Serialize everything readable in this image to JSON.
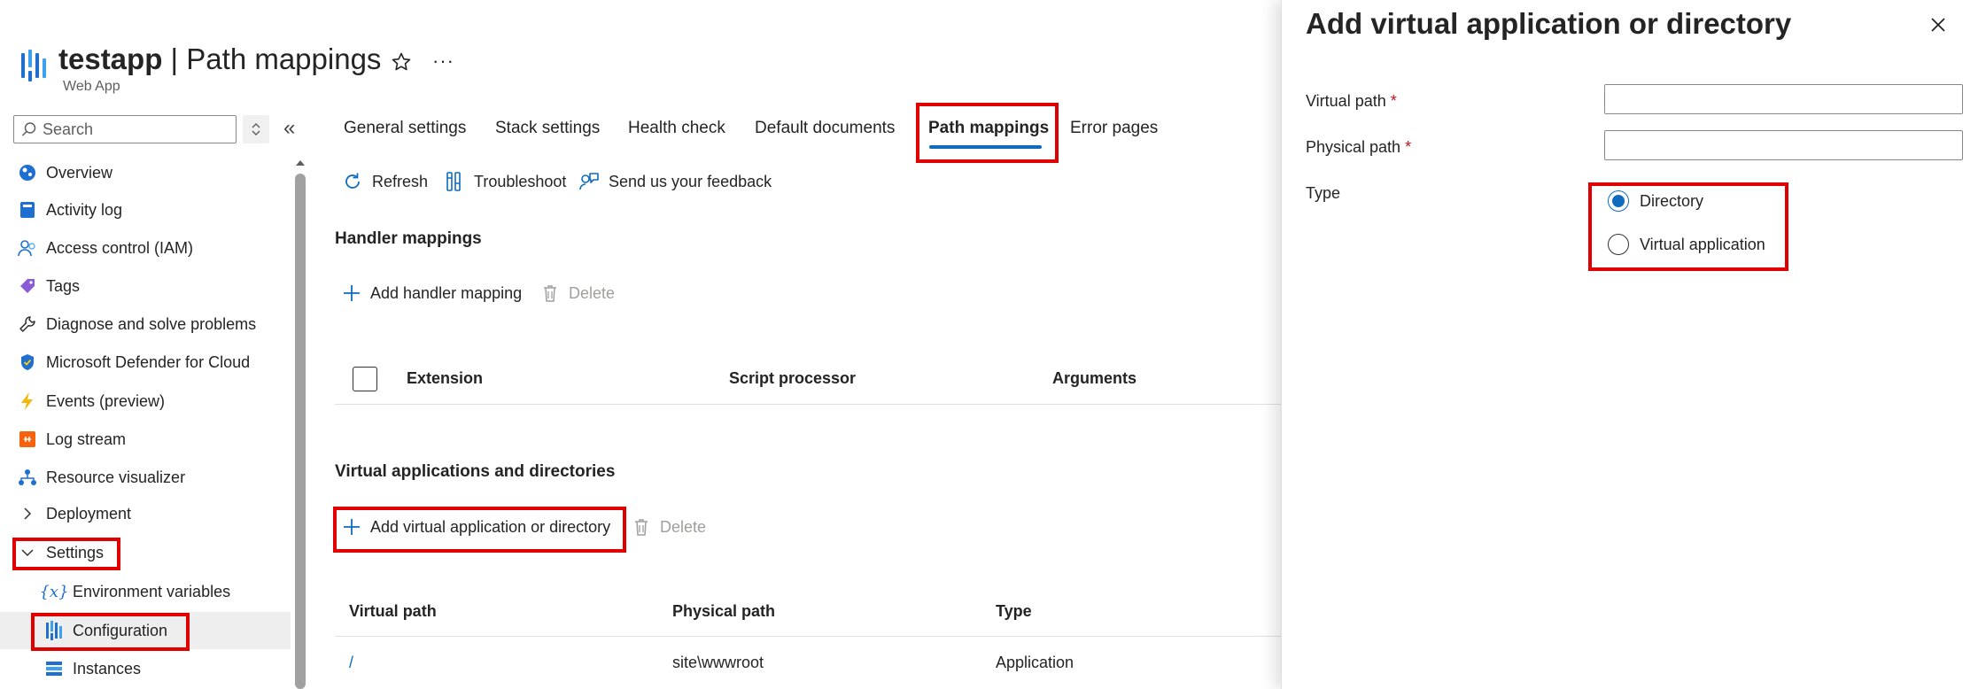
{
  "header": {
    "app_name": "testapp",
    "separator": " | ",
    "page_title": "Path mappings",
    "subtitle": "Web App",
    "more_label": "···"
  },
  "search": {
    "placeholder": "Search"
  },
  "sidebar": {
    "items": [
      {
        "label": "Overview",
        "icon": "globe-icon"
      },
      {
        "label": "Activity log",
        "icon": "book-icon"
      },
      {
        "label": "Access control (IAM)",
        "icon": "people-icon"
      },
      {
        "label": "Tags",
        "icon": "tag-icon"
      },
      {
        "label": "Diagnose and solve problems",
        "icon": "wrench-icon"
      },
      {
        "label": "Microsoft Defender for Cloud",
        "icon": "shield-icon"
      },
      {
        "label": "Events (preview)",
        "icon": "lightning-icon"
      },
      {
        "label": "Log stream",
        "icon": "log-stream-icon"
      },
      {
        "label": "Resource visualizer",
        "icon": "hierarchy-icon"
      },
      {
        "label": "Deployment",
        "icon": "chevron-right-icon"
      },
      {
        "label": "Settings",
        "icon": "chevron-down-icon"
      },
      {
        "label": "Environment variables",
        "icon": "variable-icon"
      },
      {
        "label": "Configuration",
        "icon": "configuration-icon"
      },
      {
        "label": "Instances",
        "icon": "instances-icon"
      }
    ]
  },
  "tabs": [
    {
      "label": "General settings"
    },
    {
      "label": "Stack settings"
    },
    {
      "label": "Health check"
    },
    {
      "label": "Default documents"
    },
    {
      "label": "Path mappings",
      "active": true
    },
    {
      "label": "Error pages"
    }
  ],
  "toolbar": {
    "refresh": "Refresh",
    "troubleshoot": "Troubleshoot",
    "feedback": "Send us your feedback"
  },
  "handler_mappings": {
    "title": "Handler mappings",
    "add_label": "Add handler mapping",
    "delete_label": "Delete",
    "columns": [
      "Extension",
      "Script processor",
      "Arguments"
    ]
  },
  "virtual_apps": {
    "title": "Virtual applications and directories",
    "add_label": "Add virtual application or directory",
    "delete_label": "Delete",
    "columns": [
      "Virtual path",
      "Physical path",
      "Type"
    ],
    "rows": [
      {
        "virtual_path": "/",
        "physical_path": "site\\wwwroot",
        "type": "Application"
      }
    ]
  },
  "panel": {
    "title": "Add virtual application or directory",
    "virtual_path_label": "Virtual path",
    "physical_path_label": "Physical path",
    "required_mark": "*",
    "virtual_path_value": "",
    "physical_path_value": "",
    "type_label": "Type",
    "type_options": [
      {
        "label": "Directory",
        "selected": true
      },
      {
        "label": "Virtual application",
        "selected": false
      }
    ]
  },
  "colors": {
    "accent": "#0f6cbd",
    "highlight": "#e00000"
  }
}
